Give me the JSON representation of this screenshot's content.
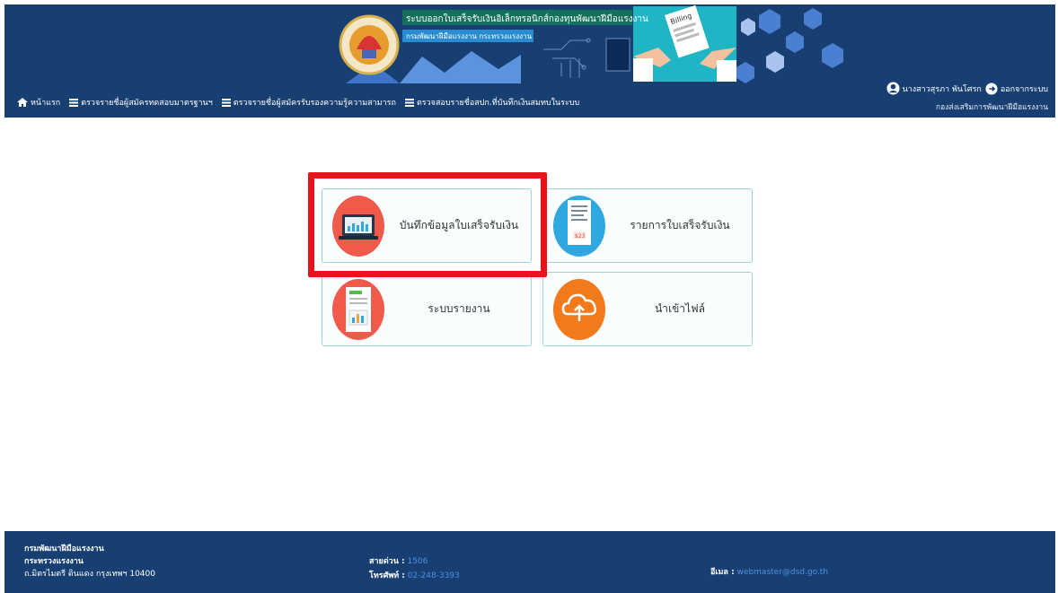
{
  "header": {
    "title_th": "ระบบออกใบเสร็จรับเงินอิเล็กทรอนิกส์กองทุนพัฒนาฝีมือแรงงาน",
    "subtitle_th": "กรมพัฒนาฝีมือแรงงาน กระทรวงแรงงาน",
    "receipt_word": "Billing"
  },
  "nav": {
    "items": [
      {
        "label": "หน้าแรก",
        "icon": "home-icon"
      },
      {
        "label": "ตรวจรายชื่อผู้สมัครทดสอบมาตรฐานฯ",
        "icon": "list-icon"
      },
      {
        "label": "ตรวจรายชื่อผู้สมัครรับรองความรู้ความสามารถ",
        "icon": "list-icon"
      },
      {
        "label": "ตรวจสอบรายชื่อสปก.ที่บันทึกเงินสมทบในระบบ",
        "icon": "list-icon"
      }
    ]
  },
  "user": {
    "name": "นางสาวสุรภา พันโศรก",
    "logout": "ออกจากระบบ",
    "department": "กองส่งเสริมการพัฒนาฝีมือแรงงาน"
  },
  "menu": {
    "cards": [
      {
        "label": "บันทึกข้อมูลใบเสร็จรับเงิน",
        "icon": "laptop-chart-icon",
        "color": "#ef5a4a"
      },
      {
        "label": "รายการใบเสร็จรับเงิน",
        "icon": "receipt-icon",
        "color": "#2fa8df",
        "amount": "$23"
      },
      {
        "label": "ระบบรายงาน",
        "icon": "report-icon",
        "color": "#ef5a4a"
      },
      {
        "label": "นำเข้าไฟล์",
        "icon": "cloud-upload-icon",
        "color": "#f07a1c"
      }
    ]
  },
  "footer": {
    "org1": "กรมพัฒนาฝีมือแรงงาน",
    "org2": "กระทรวงแรงงาน",
    "address": "ถ.มิตรไมตรี ดินแดง กรุงเทพฯ 10400",
    "hotline_label": "สายด่วน :",
    "hotline": "1506",
    "phone_label": "โทรศัพท์ :",
    "phone": "02-248-3393",
    "email_label": "อีเมล :",
    "email": "webmaster@dsd.go.th"
  },
  "colors": {
    "header_bg": "#173f72",
    "highlight": "#e8141c",
    "card_border": "#9fd3dc"
  }
}
